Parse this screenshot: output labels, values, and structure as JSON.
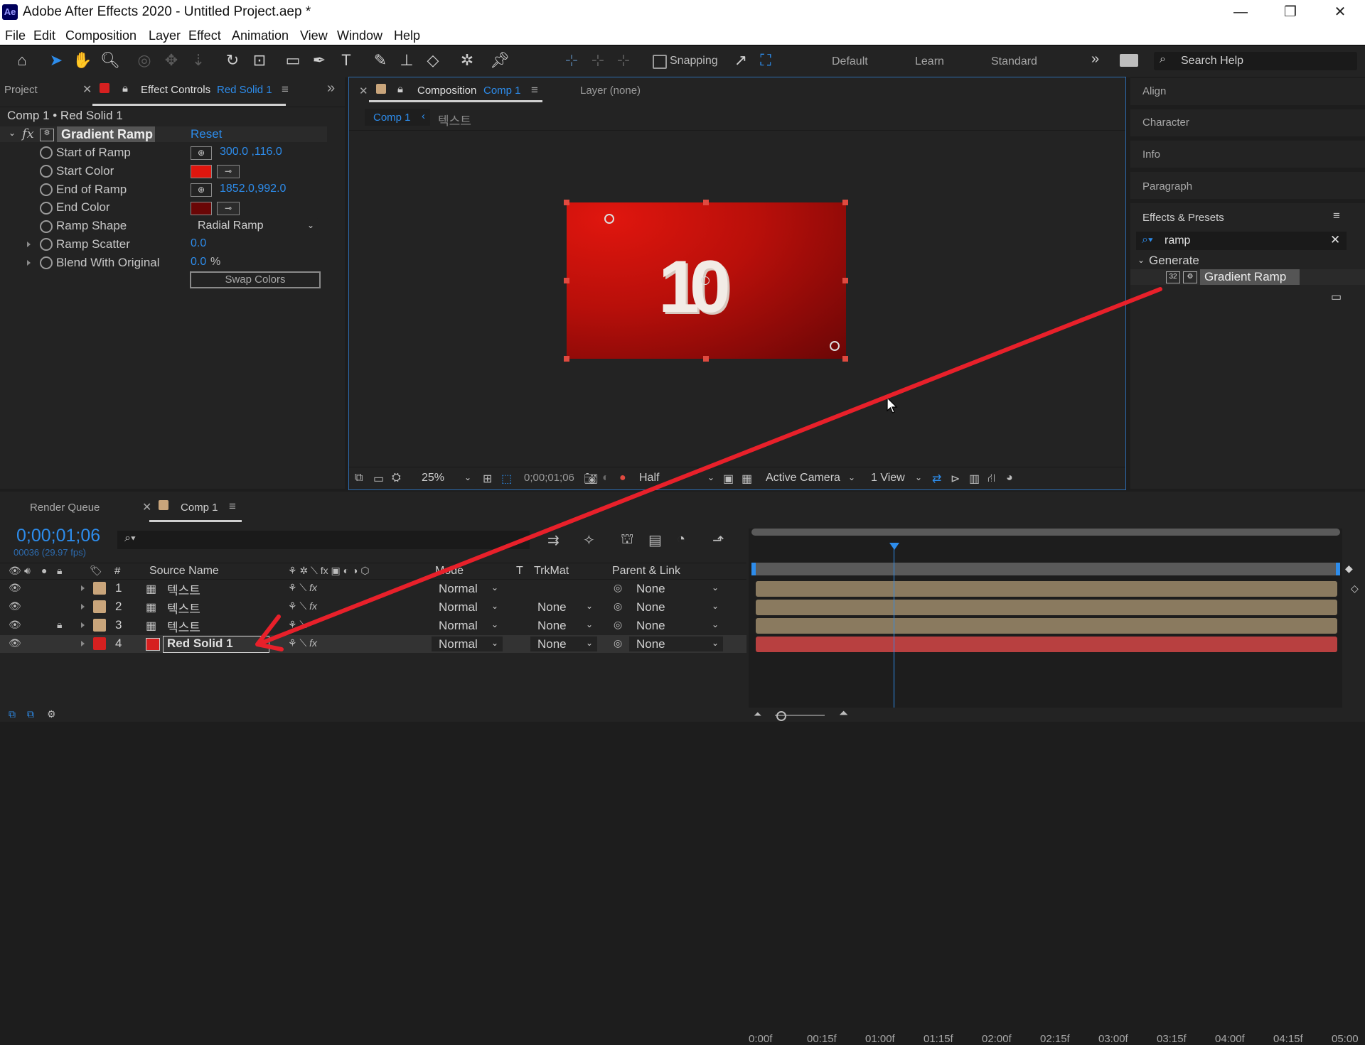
{
  "window": {
    "title": "Adobe After Effects 2020 - Untitled Project.aep *",
    "app_icon": "Ae",
    "minimize": "—",
    "restore": "❐",
    "close": "✕"
  },
  "menu": [
    "File",
    "Edit",
    "Composition",
    "Layer",
    "Effect",
    "Animation",
    "View",
    "Window",
    "Help"
  ],
  "toolbar": {
    "snapping": "Snapping",
    "workspaces": [
      "Default",
      "Learn",
      "Standard"
    ],
    "more": "»",
    "search_placeholder": "Search Help"
  },
  "left_panel": {
    "project_tab": "Project",
    "effect_controls_tab": "Effect Controls",
    "effect_controls_target": "Red Solid 1",
    "breadcrumb": "Comp 1 • Red Solid 1",
    "effect_name": "Gradient Ramp",
    "fx": "fx",
    "reset": "Reset",
    "props": [
      {
        "label": "Start of Ramp",
        "value": "300.0 ,116.0"
      },
      {
        "label": "Start Color",
        "value": ""
      },
      {
        "label": "End of Ramp",
        "value": "1852.0,992.0"
      },
      {
        "label": "End Color",
        "value": ""
      },
      {
        "label": "Ramp Shape",
        "value": "Radial Ramp"
      },
      {
        "label": "Ramp Scatter",
        "value": "0.0"
      },
      {
        "label": "Blend With Original",
        "value": "0.0",
        "unit": "%"
      }
    ],
    "swap_colors": "Swap Colors",
    "start_color": "#e0160e",
    "end_color": "#6a0606"
  },
  "comp_panel": {
    "tab_label": "Composition",
    "tab_comp": "Comp 1",
    "layer_tab": "Layer (none)",
    "nav_comp": "Comp 1",
    "nav_layer": "텍스트",
    "center_text": "10",
    "zoom": "25%",
    "timecode": "0;00;01;06",
    "resolution": "Half",
    "camera": "Active Camera",
    "views": "1 View"
  },
  "right_panel": {
    "items": [
      "Align",
      "Character",
      "Info",
      "Paragraph",
      "Effects & Presets"
    ],
    "search_value": "ramp",
    "group": "Generate",
    "result": "Gradient Ramp",
    "result_badge": "32"
  },
  "timeline": {
    "render_queue_tab": "Render Queue",
    "comp_tab": "Comp 1",
    "timecode": "0;00;01;06",
    "frames": "00036 (29.97 fps)",
    "columns": {
      "num": "#",
      "source": "Source Name",
      "mode": "Mode",
      "t": "T",
      "trkmat": "TrkMat",
      "parent": "Parent & Link"
    },
    "ruler": [
      "0:00f",
      "00:15f",
      "01:00f",
      "01:15f",
      "02:00f",
      "02:15f",
      "03:00f",
      "03:15f",
      "04:00f",
      "04:15f",
      "05:00"
    ],
    "layers": [
      {
        "num": "1",
        "name": "텍스트",
        "mode": "Normal",
        "trkmat": "",
        "parent": "None",
        "color": "#c9a57b",
        "fx": true
      },
      {
        "num": "2",
        "name": "텍스트",
        "mode": "Normal",
        "trkmat": "None",
        "parent": "None",
        "color": "#c9a57b",
        "fx": true
      },
      {
        "num": "3",
        "name": "텍스트",
        "mode": "Normal",
        "trkmat": "None",
        "parent": "None",
        "color": "#c9a57b",
        "fx": false
      },
      {
        "num": "4",
        "name": "Red Solid 1",
        "mode": "Normal",
        "trkmat": "None",
        "parent": "None",
        "color": "#d62020",
        "fx": true
      }
    ]
  },
  "colors": {
    "accent_blue": "#2d8ceb",
    "annotation_red": "#e8202a",
    "text_bar": "#8a7a5f",
    "solid_bar": "#b84040"
  }
}
